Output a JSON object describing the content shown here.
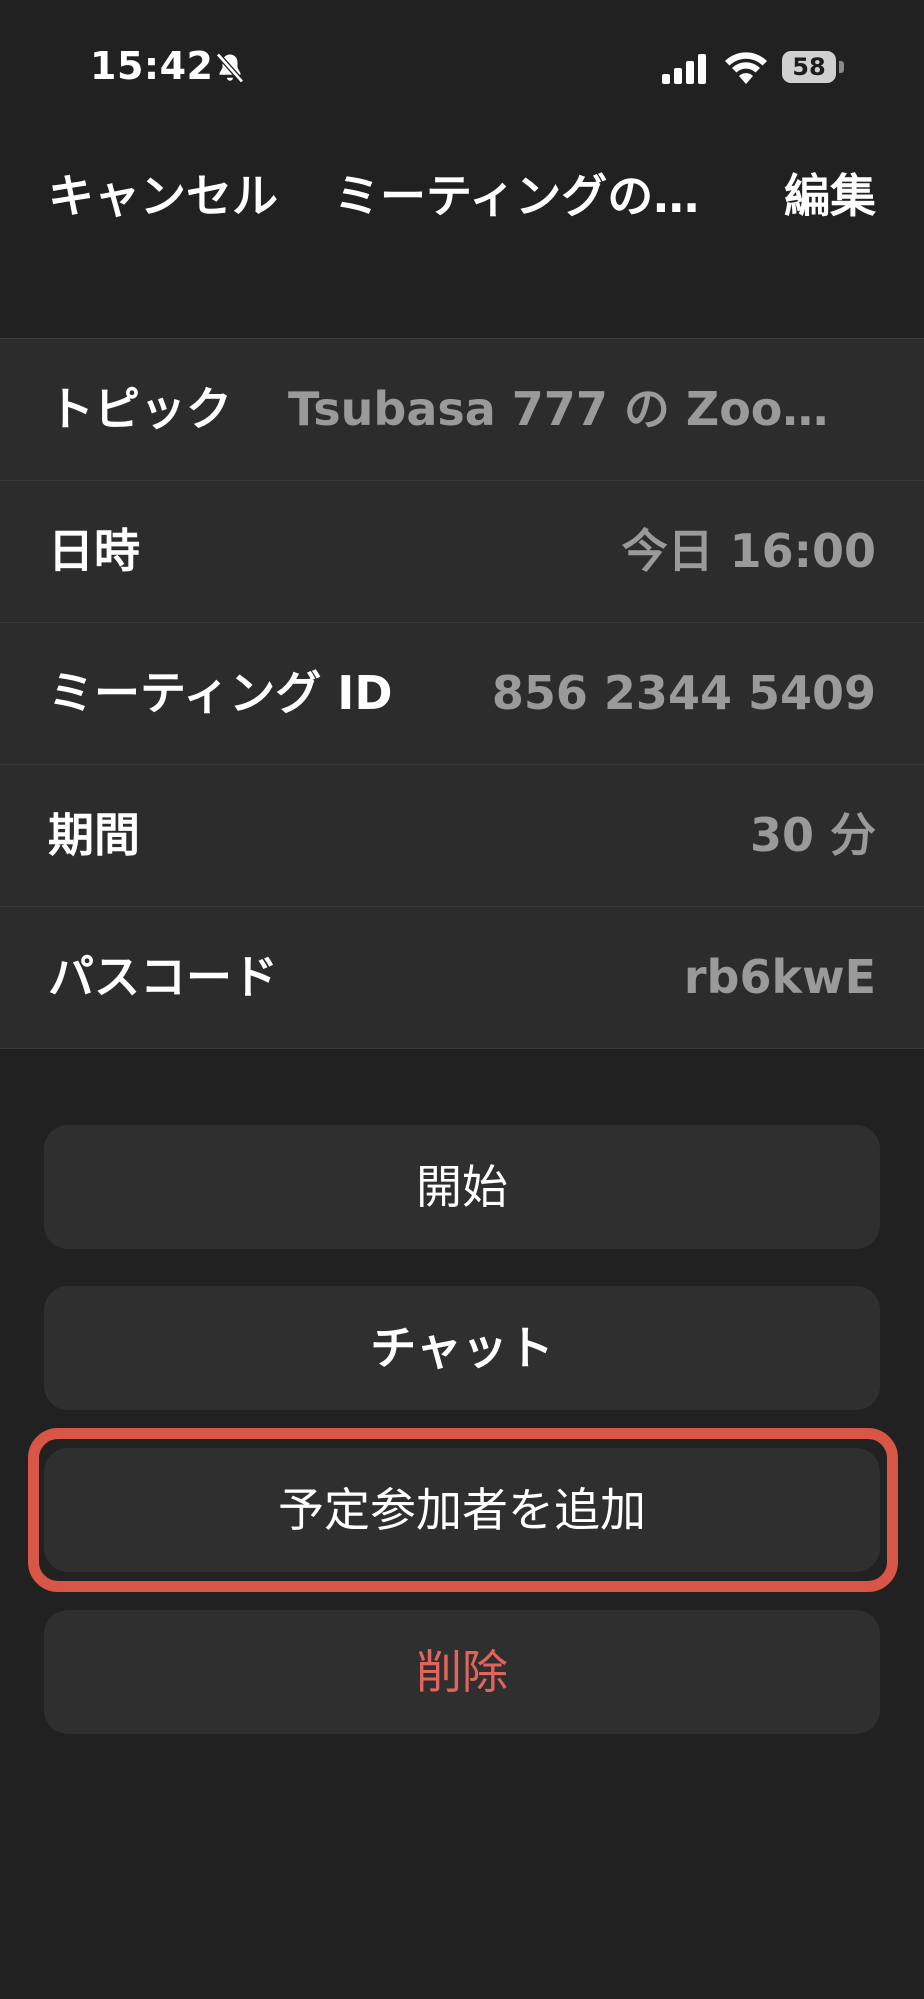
{
  "status_bar": {
    "time": "15:42",
    "battery": "58",
    "icons": [
      "silent-bell-icon",
      "signal-icon",
      "wifi-icon",
      "battery-icon"
    ]
  },
  "nav": {
    "cancel": "キャンセル",
    "title": "ミーティングの…",
    "edit": "編集"
  },
  "details": [
    {
      "label": "トピック",
      "value": "Tsubasa 777 の Zoom..."
    },
    {
      "label": "日時",
      "value": "今日 16:00"
    },
    {
      "label": "ミーティング ID",
      "value": "856 2344 5409"
    },
    {
      "label": "期間",
      "value": "30 分"
    },
    {
      "label": "パスコード",
      "value": "rb6kwE"
    }
  ],
  "buttons": {
    "start": "開始",
    "chat": "チャット",
    "add_invitees": "予定参加者を追加",
    "delete": "削除"
  },
  "colors": {
    "background": "#212121",
    "list_background": "#2c2c2c",
    "button_background": "#2f2f2f",
    "delete_text": "#e3645c",
    "highlight_border": "#d85645"
  }
}
